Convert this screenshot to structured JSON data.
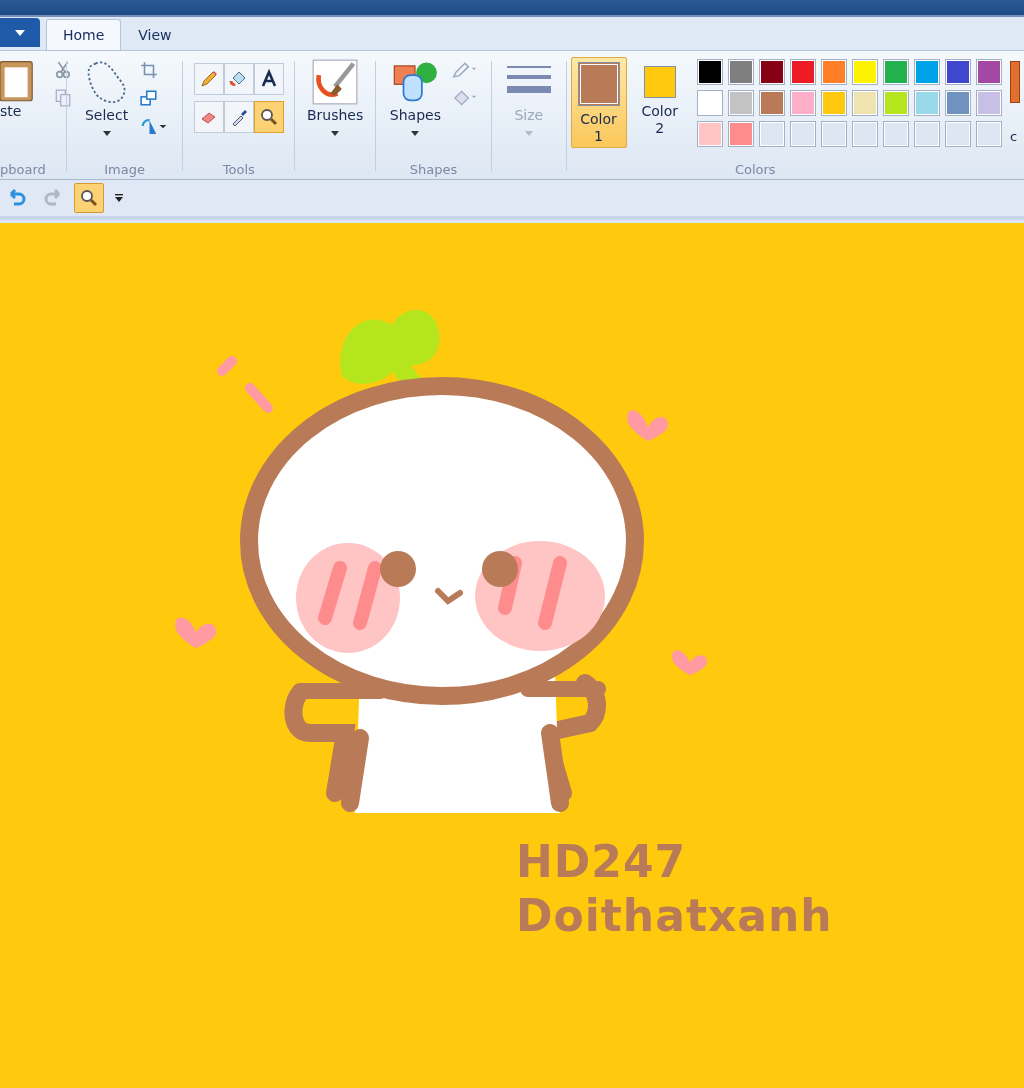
{
  "tabs": [
    {
      "label": "Home",
      "selected": true
    },
    {
      "label": "View",
      "selected": false
    }
  ],
  "ribbon": {
    "clipboard": {
      "paste_label": "ste",
      "group_label": "pboard"
    },
    "image": {
      "select_label": "Select",
      "group_label": "Image"
    },
    "tools": {
      "items": [
        {
          "kind": "pencil",
          "selected": false
        },
        {
          "kind": "fill",
          "selected": false
        },
        {
          "kind": "text",
          "selected": false
        },
        {
          "kind": "eraser",
          "selected": false
        },
        {
          "kind": "picker",
          "selected": false
        },
        {
          "kind": "magnifier",
          "selected": true
        }
      ],
      "group_label": "Tools"
    },
    "brushes": {
      "label": "Brushes"
    },
    "shapes": {
      "label": "Shapes",
      "group_label": "Shapes"
    },
    "size": {
      "label": "Size",
      "disabled": true
    },
    "colors": {
      "color1": {
        "label": "Color",
        "number": "1",
        "color": "#b97a57",
        "selected": true
      },
      "color2": {
        "label": "Color",
        "number": "2",
        "color": "#ffc90e",
        "selected": false
      },
      "palette": [
        {
          "color": "#000000"
        },
        {
          "color": "#7f7f7f"
        },
        {
          "color": "#880015"
        },
        {
          "color": "#ed1c24"
        },
        {
          "color": "#ff7f27"
        },
        {
          "color": "#fff200"
        },
        {
          "color": "#22b14c"
        },
        {
          "color": "#00a2e8"
        },
        {
          "color": "#3f48cc"
        },
        {
          "color": "#a349a4"
        },
        {
          "color": "#ffffff"
        },
        {
          "color": "#c3c3c3"
        },
        {
          "color": "#b97a57"
        },
        {
          "color": "#ffaec9"
        },
        {
          "color": "#ffc90e"
        },
        {
          "color": "#efe4b0"
        },
        {
          "color": "#b5e61d"
        },
        {
          "color": "#99d9ea"
        },
        {
          "color": "#7092be"
        },
        {
          "color": "#c8bfe7"
        },
        {
          "color": "#ffc4c4"
        },
        {
          "color": "#ff8c8c"
        },
        {
          "kind": "empty"
        },
        {
          "kind": "empty"
        },
        {
          "kind": "empty"
        },
        {
          "kind": "empty"
        },
        {
          "kind": "empty"
        },
        {
          "kind": "empty"
        },
        {
          "kind": "empty"
        },
        {
          "kind": "empty"
        }
      ],
      "group_label": "Colors",
      "edit_label": "c"
    }
  },
  "quick_access": [
    {
      "kind": "undo",
      "selected": false
    },
    {
      "kind": "redo",
      "selected": false
    },
    {
      "kind": "magnifier",
      "selected": true
    }
  ],
  "canvas": {
    "texts": [
      "HD247",
      "Doithatxanh"
    ]
  }
}
